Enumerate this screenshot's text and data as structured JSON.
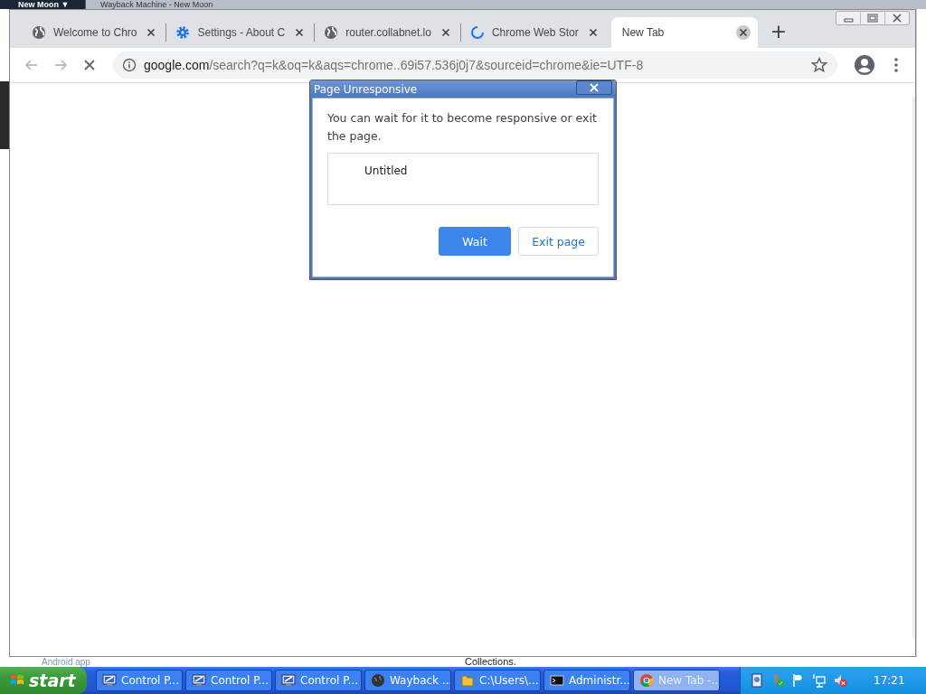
{
  "background_window": {
    "menu_button": "New Moon ▼",
    "title": "Wayback Machine - New Moon",
    "footer_texts": [
      "Android app",
      "Collections."
    ]
  },
  "browser": {
    "tabs": [
      {
        "kind": "site",
        "title": "Welcome to Chro",
        "selected": false
      },
      {
        "kind": "settings",
        "title": "Settings - About C",
        "selected": false
      },
      {
        "kind": "site",
        "title": "router.collabnet.lo",
        "selected": false
      },
      {
        "kind": "loading",
        "title": "Chrome Web Stor",
        "selected": false
      },
      {
        "kind": "blank",
        "title": "New Tab",
        "selected": true
      }
    ],
    "new_tab_button": "+",
    "toolbar": {
      "back_disabled": true,
      "forward_disabled": true,
      "loading": true
    },
    "address": {
      "host": "google.com",
      "path": "/search?q=k&oq=k&aqs=chrome..69i57.536j0j7&sourceid=chrome&ie=UTF-8"
    }
  },
  "dialog": {
    "title": "Page Unresponsive",
    "message": "You can wait for it to become responsive or exit the page.",
    "pages": [
      "Untitled"
    ],
    "buttons": [
      {
        "label": "Wait",
        "primary": true
      },
      {
        "label": "Exit page",
        "primary": false
      }
    ]
  },
  "taskbar": {
    "start": "start",
    "items": [
      {
        "kind": "control-panel",
        "label": "Control P...",
        "selected": false
      },
      {
        "kind": "control-panel",
        "label": "Control P...",
        "selected": false
      },
      {
        "kind": "control-panel",
        "label": "Control P...",
        "selected": false
      },
      {
        "kind": "globe",
        "label": "Wayback ...",
        "selected": false
      },
      {
        "kind": "folder",
        "label": "C:\\Users\\...",
        "selected": false
      },
      {
        "kind": "console",
        "label": "Administr...",
        "selected": false
      },
      {
        "kind": "browser",
        "label": "New Tab -...",
        "selected": true
      }
    ],
    "clock": "17:21"
  }
}
